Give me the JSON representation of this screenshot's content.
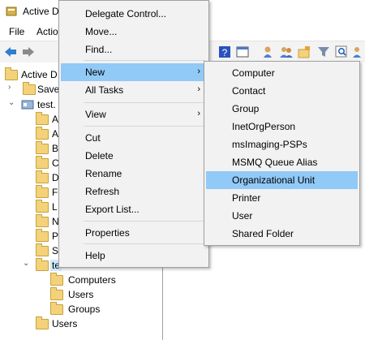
{
  "window": {
    "title": "Active Di"
  },
  "menubar": {
    "file": "File",
    "action": "Actio"
  },
  "tree": {
    "root": "Active D",
    "saved": "Save",
    "domain": "test.",
    "children": [
      {
        "label": "A"
      },
      {
        "label": "A"
      },
      {
        "label": "B"
      },
      {
        "label": "C"
      },
      {
        "label": "D"
      },
      {
        "label": "F"
      },
      {
        "label": "L"
      },
      {
        "label": "N"
      },
      {
        "label": "P"
      },
      {
        "label": "S"
      }
    ],
    "selected_ou": "te",
    "ou_children": [
      "Computers",
      "Users",
      "Groups"
    ],
    "users": "Users"
  },
  "context_menu": {
    "delegate": "Delegate Control...",
    "move": "Move...",
    "find": "Find...",
    "new": "New",
    "all_tasks": "All Tasks",
    "view": "View",
    "cut": "Cut",
    "delete": "Delete",
    "rename": "Rename",
    "refresh": "Refresh",
    "export": "Export List...",
    "properties": "Properties",
    "help": "Help"
  },
  "submenu": {
    "computer": "Computer",
    "contact": "Contact",
    "group": "Group",
    "inetorgperson": "InetOrgPerson",
    "msimaging": "msImaging-PSPs",
    "msmq": "MSMQ Queue Alias",
    "ou": "Organizational Unit",
    "printer": "Printer",
    "user": "User",
    "shared_folder": "Shared Folder"
  },
  "colors": {
    "highlight": "#91c9f7",
    "menu_bg": "#f2f2f2",
    "folder": "#f3d27a"
  }
}
